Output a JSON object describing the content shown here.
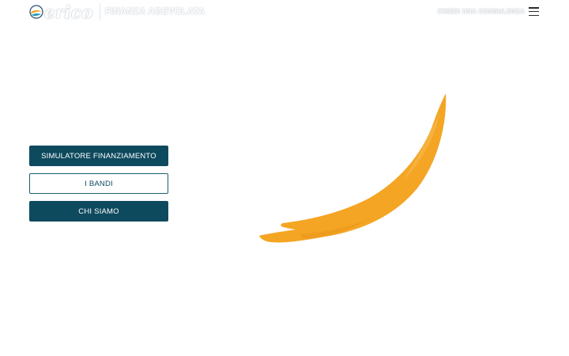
{
  "header": {
    "brand_name": "erico",
    "brand_tagline": "FINANZA AGEVOLATA",
    "cta_label": "CHIEDI UNA CONSULENZA",
    "menu_icon": "hamburger-menu-icon"
  },
  "hero": {
    "buttons": [
      {
        "label": "SIMULATORE FINANZIAMENTO",
        "style": "solid"
      },
      {
        "label": "I BANDI",
        "style": "outline"
      },
      {
        "label": "CHI SIAMO",
        "style": "solid"
      }
    ],
    "decoration": "orange-brush-stroke"
  },
  "colors": {
    "primary": "#0e4a5e",
    "accent": "#f4a523",
    "background": "#ffffff"
  }
}
